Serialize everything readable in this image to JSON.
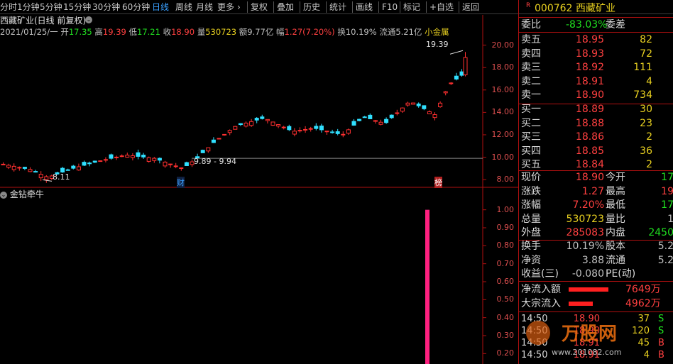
{
  "toolbar": {
    "items": [
      "分时",
      "1分钟",
      "5分钟",
      "15分钟",
      "30分钟",
      "60分钟",
      "日线",
      "周线",
      "月线",
      "更多",
      "复权",
      "叠加",
      "历史",
      "统计",
      "画线",
      "F10",
      "标记",
      "+自选",
      "返回"
    ],
    "more_arrow": "›"
  },
  "quote_bar": {
    "title": "西藏矿业(日线 前复权)",
    "date": "2021/01/25/一",
    "open_label": "开",
    "open": "17.35",
    "high_label": "高",
    "high": "19.39",
    "low_label": "低",
    "low": "17.21",
    "close_label": "收",
    "close": "18.90",
    "vol_label": "量",
    "vol": "530723",
    "amt_label": "额",
    "amt": "9.77亿",
    "chg_label": "幅",
    "chg": "1.27(7.20%)",
    "turn_label": "换",
    "turn": "10.19%",
    "float_label": "流通",
    "float": "5.21亿",
    "concept": "小金属"
  },
  "annotations": {
    "high": "19.39",
    "low": "8.11",
    "range": "9.89 - 9.94",
    "cai": "财",
    "bang": "榜"
  },
  "indicator": {
    "name": "金钻牵牛",
    "ticks": [
      "1.00",
      "0.90",
      "0.80",
      "0.70",
      "0.60",
      "0.50",
      "0.40",
      "0.30",
      "0.20"
    ]
  },
  "price_ticks": [
    "20.00",
    "18.00",
    "16.00",
    "14.00",
    "12.00",
    "10.00",
    "8.00"
  ],
  "chart_data": {
    "type": "candlestick",
    "title": "西藏矿业(日线 前复权)",
    "ylim": [
      7.5,
      20.8
    ],
    "yticks": [
      8,
      10,
      12,
      14,
      16,
      18,
      20
    ],
    "last": {
      "open": 17.35,
      "high": 19.39,
      "low": 17.21,
      "close": 18.9
    },
    "annotated_low": 8.11,
    "annotated_high": 19.39,
    "indicator": {
      "name": "金钻牵牛",
      "ylim": [
        0.15,
        1.05
      ],
      "signal_value": 1.0
    }
  },
  "stock": {
    "flag": "R",
    "code": "000762",
    "name": "西藏矿业"
  },
  "weibi": {
    "label": "委比",
    "value": "-83.03%",
    "label2": "委差"
  },
  "sell": [
    {
      "label": "卖五",
      "price": "18.95",
      "vol": "82"
    },
    {
      "label": "卖四",
      "price": "18.93",
      "vol": "72"
    },
    {
      "label": "卖三",
      "price": "18.92",
      "vol": "111"
    },
    {
      "label": "卖二",
      "price": "18.91",
      "vol": "4"
    },
    {
      "label": "卖一",
      "price": "18.90",
      "vol": "734"
    }
  ],
  "buy": [
    {
      "label": "买一",
      "price": "18.89",
      "vol": "30"
    },
    {
      "label": "买二",
      "price": "18.88",
      "vol": "23"
    },
    {
      "label": "买三",
      "price": "18.86",
      "vol": "2"
    },
    {
      "label": "买四",
      "price": "18.85",
      "vol": "36"
    },
    {
      "label": "买五",
      "price": "18.84",
      "vol": "2"
    }
  ],
  "stats": [
    {
      "l1": "现价",
      "v1": "18.90",
      "l2": "今开",
      "v2": "17"
    },
    {
      "l1": "涨跌",
      "v1": "1.27",
      "l2": "最高",
      "v2": "19"
    },
    {
      "l1": "涨幅",
      "v1": "7.20%",
      "l2": "最低",
      "v2": "17"
    },
    {
      "l1": "总量",
      "v1": "530723",
      "l2": "量比",
      "v2": "1"
    },
    {
      "l1": "外盘",
      "v1": "285083",
      "l2": "内盘",
      "v2": "2450"
    }
  ],
  "stats2": [
    {
      "l1": "换手",
      "v1": "10.19%",
      "l2": "股本",
      "v2": "5.2"
    },
    {
      "l1": "净资",
      "v1": "3.88",
      "l2": "流通",
      "v2": "5.2"
    },
    {
      "l1": "收益(三)",
      "v1": "-0.080",
      "l2": "PE(动)",
      "v2": ""
    }
  ],
  "flows": [
    {
      "label": "净流入额",
      "value": "7649万",
      "bar": 0.9
    },
    {
      "label": "大宗流入",
      "value": "4962万",
      "bar": 0.55
    }
  ],
  "ticks": [
    {
      "time": "14:50",
      "price": "18.90",
      "vol": "37",
      "side": "S"
    },
    {
      "time": "14:50",
      "price": "18.90",
      "vol": "120",
      "side": "S"
    },
    {
      "time": "14:50",
      "price": "18.91",
      "vol": "45",
      "side": "B"
    },
    {
      "time": "14:50",
      "price": "18.91",
      "vol": "4",
      "side": "B"
    }
  ],
  "watermark": {
    "name": "万股网",
    "url": "www.201082.com"
  }
}
